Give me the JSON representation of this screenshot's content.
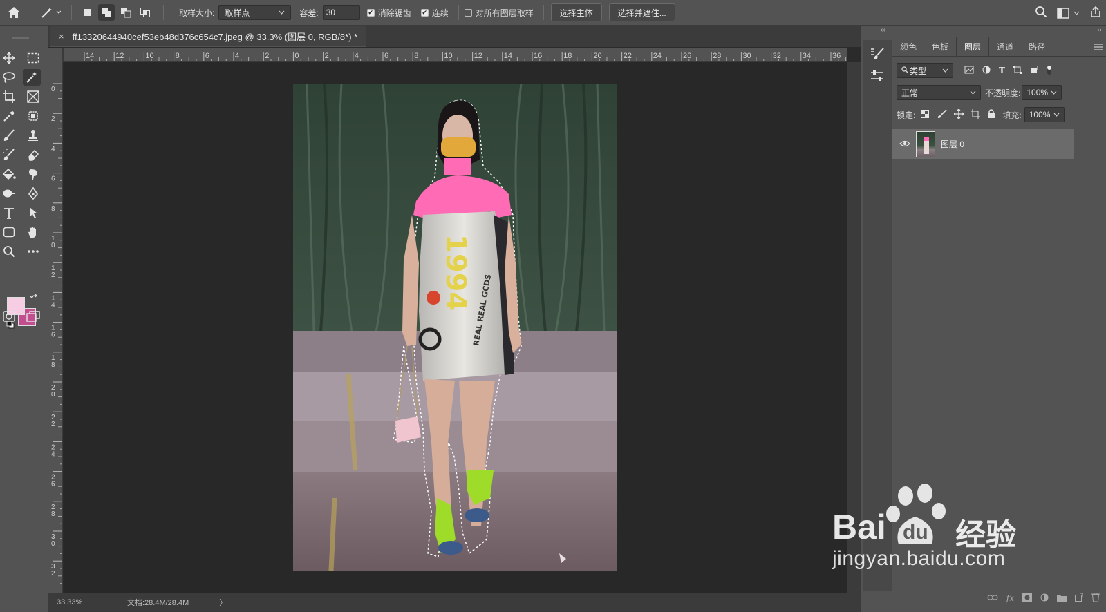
{
  "options_bar": {
    "sample_size_label": "取样大小:",
    "sample_size_value": "取样点",
    "tolerance_label": "容差:",
    "tolerance_value": "30",
    "antialias_label": "消除锯齿",
    "contiguous_label": "连续",
    "sample_all_layers_label": "对所有图层取样",
    "select_subject_label": "选择主体",
    "select_and_mask_label": "选择并遮住..."
  },
  "document": {
    "tab_title": "ff13320644940cef53eb48d376c654c7.jpeg @ 33.3% (图层 0, RGB/8*) *",
    "close_glyph": "×"
  },
  "ruler": {
    "top_labels": [
      "14",
      "12",
      "10",
      "8",
      "6",
      "4",
      "2",
      "0",
      "2",
      "4",
      "6",
      "8",
      "10",
      "12",
      "14",
      "16",
      "18",
      "20",
      "22",
      "24",
      "26",
      "28",
      "30",
      "32",
      "34",
      "36"
    ],
    "left_labels": [
      "0",
      "2",
      "4",
      "6",
      "8",
      "10",
      "12",
      "14",
      "16",
      "18",
      "20",
      "22",
      "24",
      "26",
      "28",
      "30",
      "32"
    ]
  },
  "status": {
    "zoom": "33.33%",
    "doc_size": "文档:28.4M/28.4M",
    "arrow": "〉"
  },
  "colors": {
    "foreground": "#f6cde2",
    "background": "#c24e8f"
  },
  "layers_panel": {
    "tabs": [
      "颜色",
      "色板",
      "图层",
      "通道",
      "路径"
    ],
    "active_tab": "图层",
    "filter_value": "类型",
    "blend_mode": "正常",
    "opacity_label": "不透明度:",
    "opacity_value": "100%",
    "lock_label": "锁定:",
    "fill_label": "填充:",
    "fill_value": "100%",
    "layers": [
      {
        "name": "图层 0",
        "visible": true
      }
    ]
  },
  "watermark": {
    "brand_left": "Bai",
    "brand_mid": "du",
    "brand_right": "经验",
    "url": "jingyan.baidu.com"
  }
}
